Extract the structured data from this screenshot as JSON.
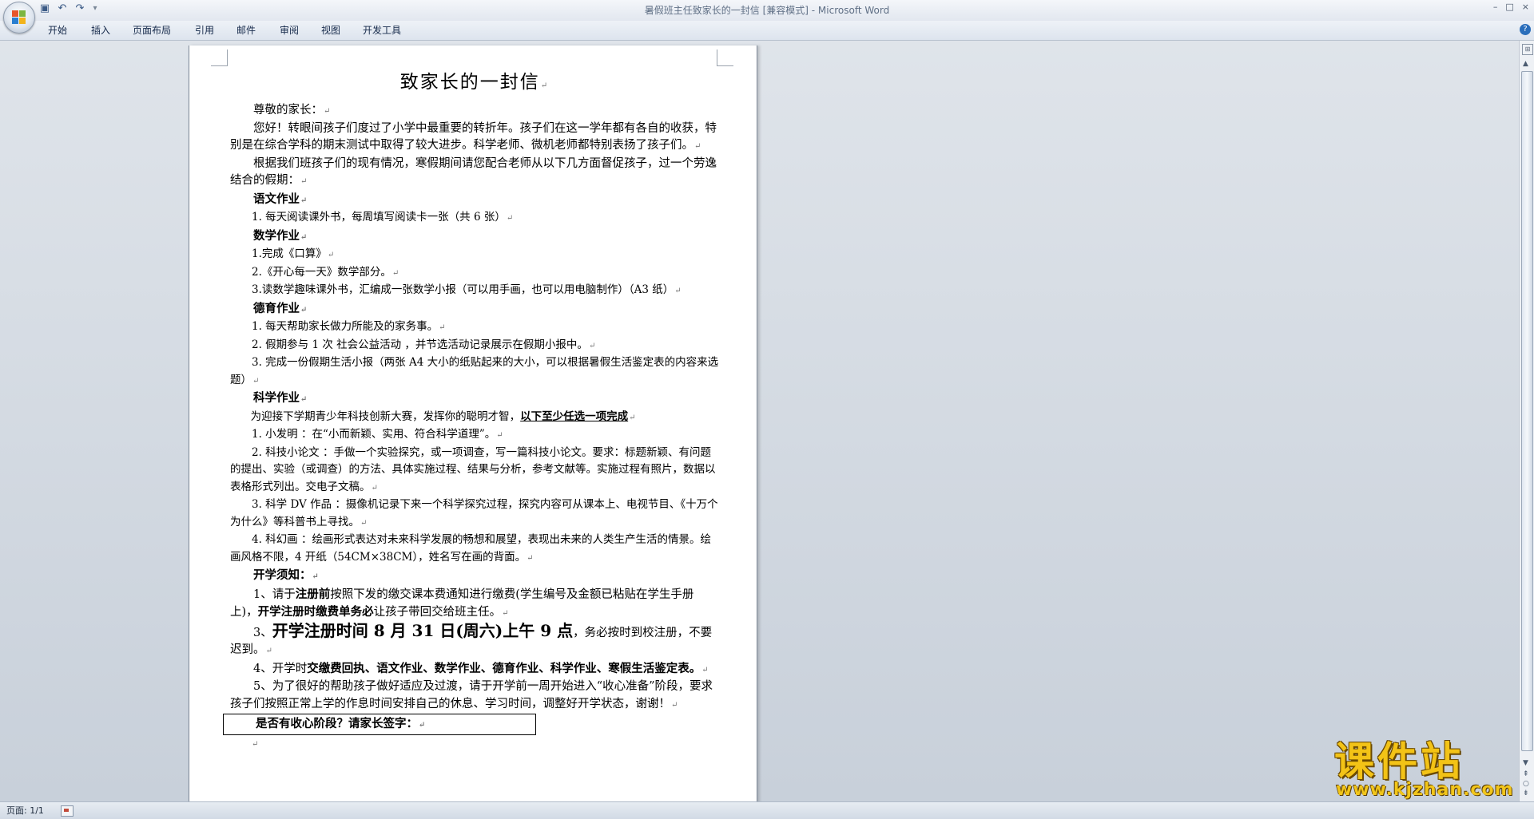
{
  "window": {
    "title": "暑假班主任致家长的一封信 [兼容模式] - Microsoft Word",
    "controls": [
      "–",
      "□",
      "×"
    ]
  },
  "quick_access": {
    "save_icon": "save-icon",
    "undo_icon": "undo-icon",
    "redo_icon": "redo-icon",
    "customize_icon": "customize-icon"
  },
  "ribbon": {
    "tabs": [
      "开始",
      "插入",
      "页面布局",
      "引用",
      "邮件",
      "审阅",
      "视图",
      "开发工具"
    ]
  },
  "document": {
    "title": "致家长的一封信",
    "greeting": "尊敬的家长：",
    "intro": "您好！转眼间孩子们度过了小学中最重要的转折年。孩子们在这一学年都有各自的收获，特别是在综合学科的期末测试中取得了较大进步。科学老师、微机老师都特别表扬了孩子们。",
    "lead": "根据我们班孩子们的现有情况，寒假期间请您配合老师从以下几方面督促孩子，过一个劳逸结合的假期：",
    "sec_chinese": "语文作业",
    "chinese_1": "1.     每天阅读课外书，每周填写阅读卡一张（共 6 张）",
    "sec_math": "数学作业",
    "math_1": "1.完成《口算》",
    "math_2": "2.《开心每一天》数学部分。",
    "math_3": "3.读数学趣味课外书，汇编成一张数学小报（可以用手画，也可以用电脑制作）（A3 纸）",
    "sec_moral": "德育作业",
    "moral_1": "1. 每天帮助家长做力所能及的家务事。",
    "moral_2": "2. 假期参与 1 次 社会公益活动 ，并节选活动记录展示在假期小报中。",
    "moral_3": "3. 完成一份假期生活小报（两张 A4 大小的纸贴起来的大小，可以根据暑假生活鉴定表的内容来选题）",
    "sec_science": "科学作业",
    "science_intro_a": "为迎接下学期青少年科技创新大赛，发挥你的聪明才智，",
    "science_intro_b": "以下至少任选一项完成",
    "science_1": "1. 小发明 ：在“小而新颖、实用、符合科学道理”。",
    "science_2": "2. 科技小论文 ：手做一个实验探究，或一项调查，写一篇科技小论文。要求：标题新颖、有问题的提出、实验（或调查）的方法、具体实施过程、结果与分析，参考文献等。实施过程有照片，数据以表格形式列出。交电子文稿。",
    "science_3": "3. 科学 DV 作品 ：摄像机记录下来一个科学探究过程，探究内容可从课本上、电视节目、《十万个为什么》等科普书上寻找。",
    "science_4": "4. 科幻画 ：绘画形式表达对未来科学发展的畅想和展望，表现出未来的人类生产生活的情景。绘画风格不限，4 开纸（54CM×38CM），姓名写在画的背面。",
    "sec_notice": "开学须知",
    "notice_1_a": "1、请于",
    "notice_1_b": "注册前",
    "notice_1_c": "按照下发的缴交课本费通知进行缴费(学生编号及金额已粘贴在学生手册上)，",
    "notice_1_d": "开学注册时缴费单务必",
    "notice_1_e": "让孩子带回交给班主任。",
    "notice_3_a": "3、",
    "notice_3_b": "开学注册时间 8 月 31 日(周六)上午 9 点",
    "notice_3_c": "，务必按时到校注册，不要迟到。",
    "notice_4_a": "4、开学时",
    "notice_4_b": "交缴费回执、语文作业、数学作业、德育作业、科学作业、寒假生活鉴定表。",
    "notice_5": "5、为了很好的帮助孩子做好适应及过渡，请于开学前一周开始进入“收心准备”阶段，要求孩子们按照正常上学的作息时间安排自己的休息、学习时间，调整好开学状态，谢谢！",
    "sign_prompt": "是否有收心阶段？请家长签字：",
    "paragraph_mark": "↵"
  },
  "statusbar": {
    "page_info": "页面: 1/1"
  },
  "watermark": {
    "brand": "课件站",
    "url": "www.kjzhan.com"
  }
}
